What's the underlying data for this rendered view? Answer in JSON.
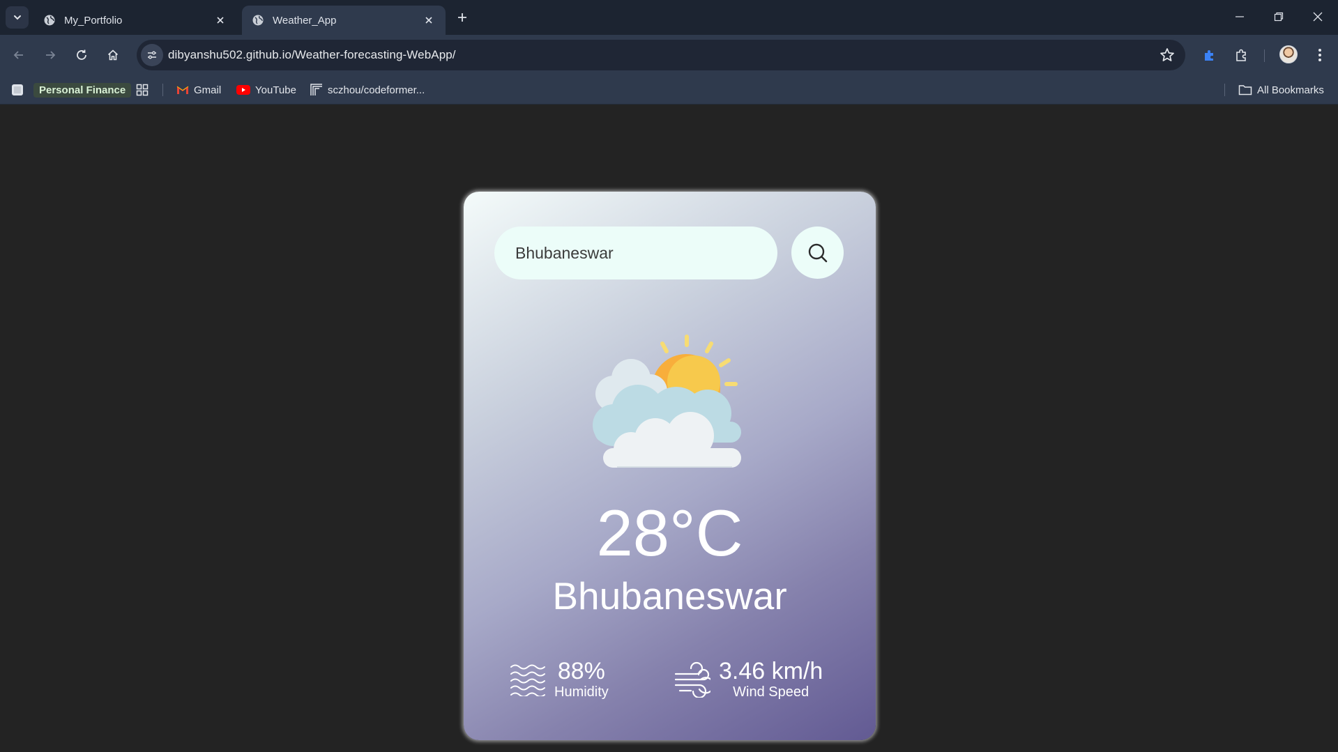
{
  "browser": {
    "tabs": [
      {
        "title": "My_Portfolio",
        "active": false
      },
      {
        "title": "Weather_App",
        "active": true
      }
    ],
    "url": "dibyanshu502.github.io/Weather-forecasting-WebApp/",
    "bookmarks": {
      "personal_finance": "Personal Finance",
      "gmail": "Gmail",
      "youtube": "YouTube",
      "codeformer": "sczhou/codeformer...",
      "all_bookmarks": "All Bookmarks"
    }
  },
  "weather": {
    "search_value": "Bhubaneswar",
    "condition_icon": "partly-cloudy-sun-icon",
    "temperature": "28°C",
    "city": "Bhubaneswar",
    "humidity_value": "88%",
    "humidity_label": "Humidity",
    "wind_value": "3.46 km/h",
    "wind_label": "Wind Speed"
  },
  "colors": {
    "page_bg": "#232323",
    "card_gradient_start": "#f4fbfa",
    "card_gradient_end": "#625a93",
    "input_bg": "#ecfdf9",
    "text": "#ffffff"
  }
}
